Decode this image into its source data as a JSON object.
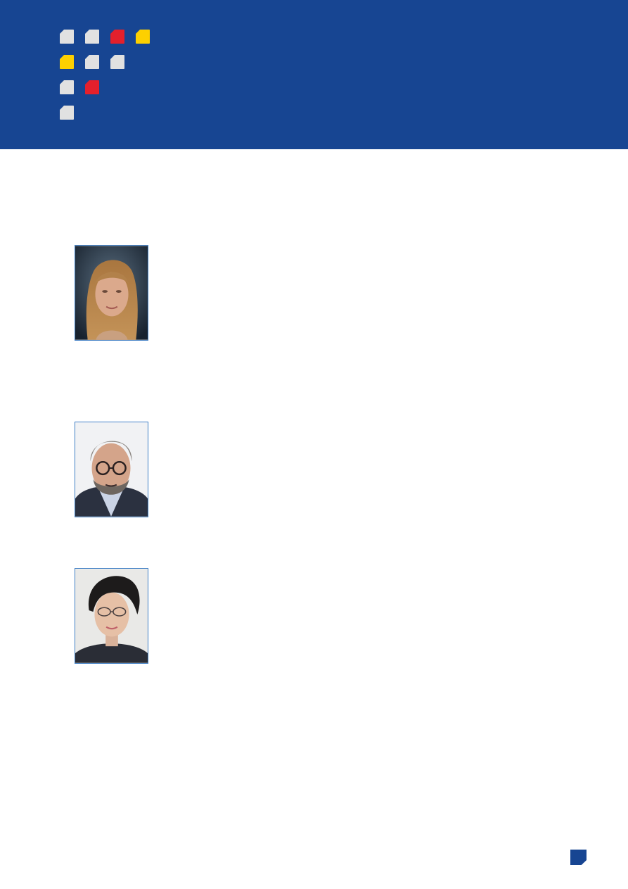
{
  "colors": {
    "brand_blue": "#174592",
    "tile_grey": "#e1e1e1",
    "tile_red": "#e4202c",
    "tile_yellow": "#fdd000",
    "photo_border": "#3f7ec4"
  },
  "decor": {
    "tile_grid": [
      [
        "grey",
        "grey",
        "red",
        "yellow"
      ],
      [
        "yellow",
        "grey",
        "grey"
      ],
      [
        "grey",
        "red"
      ],
      [
        "grey"
      ]
    ]
  },
  "portraits": [
    {
      "name": "portrait-woman-blonde",
      "description_icon": "person-photo-icon"
    },
    {
      "name": "portrait-man-glasses",
      "description_icon": "person-photo-icon"
    },
    {
      "name": "portrait-woman-glasses",
      "description_icon": "person-photo-icon"
    }
  ]
}
